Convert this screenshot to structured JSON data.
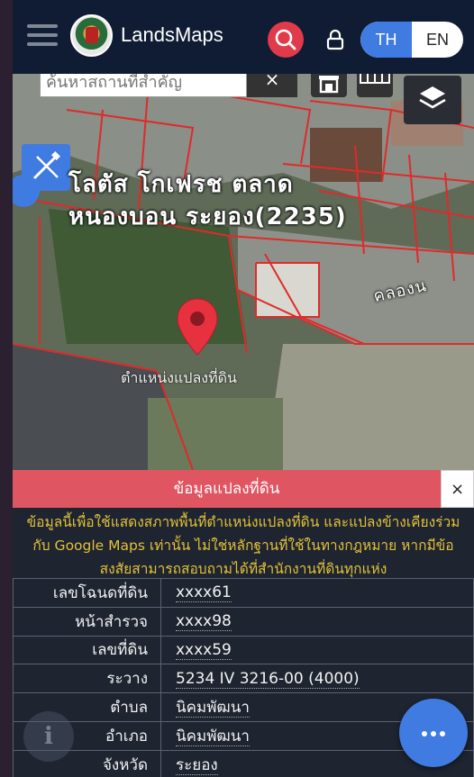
{
  "header": {
    "brand": "LandsMaps",
    "lang_th": "TH",
    "lang_en": "EN"
  },
  "map": {
    "search_placeholder": "ค้นหาสถานที่สำคัญ",
    "clear_label": "×",
    "label_line1": "โลตัส โกเฟรช ตลาด",
    "label_line2": "หนองบอน ระยอง(2235)",
    "label_road": "คลองน",
    "pin_label": "ตำแหน่งแปลงที่ดิน"
  },
  "panel": {
    "title": "ข้อมูลแปลงที่ดิน",
    "close_label": "×",
    "notice": "ข้อมูลนี้เพื่อใช้แสดงสภาพพื้นที่ตำแหน่งแปลงที่ดิน และแปลงข้างเคียงร่วมกับ Google Maps เท่านั้น ไม่ใช่หลักฐานที่ใช้ในทางกฎหมาย หากมีข้อสงสัยสามารถสอบถามได้ที่สำนักงานที่ดินทุกแห่ง",
    "rows": [
      {
        "key": "เลขโฉนดที่ดิน",
        "value": "xxxx61"
      },
      {
        "key": "หน้าสำรวจ",
        "value": "xxxx98"
      },
      {
        "key": "เลขที่ดิน",
        "value": "xxxx59"
      },
      {
        "key": "ระวาง",
        "value": "5234 IV 3216-00 (4000)"
      },
      {
        "key": "ตำบล",
        "value": "นิคมพัฒนา"
      },
      {
        "key": "อำเภอ",
        "value": "นิคมพัฒนา"
      },
      {
        "key": "จังหวัด",
        "value": "ระยอง"
      }
    ]
  },
  "colors": {
    "accent": "#3f7be0",
    "search": "#e03a4b",
    "panel_header": "#e05562",
    "notice_text": "#e2c23a",
    "parcel_line": "#e02a2a"
  },
  "icons": [
    "menu-icon",
    "search-icon",
    "lock-icon",
    "store-icon",
    "grid-icon",
    "layers-icon",
    "edit-icon",
    "location-pin-icon",
    "info-icon",
    "more-icon",
    "close-icon"
  ]
}
